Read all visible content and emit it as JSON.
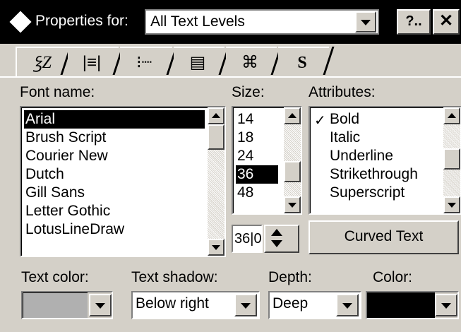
{
  "title_bar": {
    "label": "Properties for:",
    "selected_value": "All Text Levels",
    "help_label": "?..",
    "close_label": "✕"
  },
  "tabs": [
    {
      "icon": "font-icon",
      "glyph": "ꝣZ"
    },
    {
      "icon": "alignment-icon",
      "glyph": "|≡|"
    },
    {
      "icon": "bullet-icon",
      "glyph": "⁝┈"
    },
    {
      "icon": "frame-icon",
      "glyph": "▤"
    },
    {
      "icon": "effects-icon",
      "glyph": "⌘"
    },
    {
      "icon": "style-icon",
      "glyph": "S"
    }
  ],
  "font_name": {
    "label": "Font name:",
    "items": [
      "Arial",
      "Brush Script",
      "Courier New",
      "Dutch",
      "Gill Sans",
      "Letter Gothic",
      "LotusLineDraw"
    ],
    "selected_index": 0
  },
  "size": {
    "label": "Size:",
    "items": [
      "14",
      "18",
      "24",
      "36",
      "48"
    ],
    "selected_index": 3,
    "spinner_value": "36|0"
  },
  "attributes": {
    "label": "Attributes:",
    "items": [
      "Bold",
      "Italic",
      "Underline",
      "Strikethrough",
      "Superscript"
    ],
    "checked": [
      true,
      false,
      false,
      false,
      false
    ]
  },
  "curved_text_label": "Curved Text",
  "text_color": {
    "label": "Text color:",
    "color": "#b0b0b0"
  },
  "text_shadow": {
    "label": "Text shadow:",
    "value": "Below right"
  },
  "depth": {
    "label": "Depth:",
    "value": "Deep"
  },
  "color": {
    "label": "Color:",
    "color": "#000000"
  }
}
